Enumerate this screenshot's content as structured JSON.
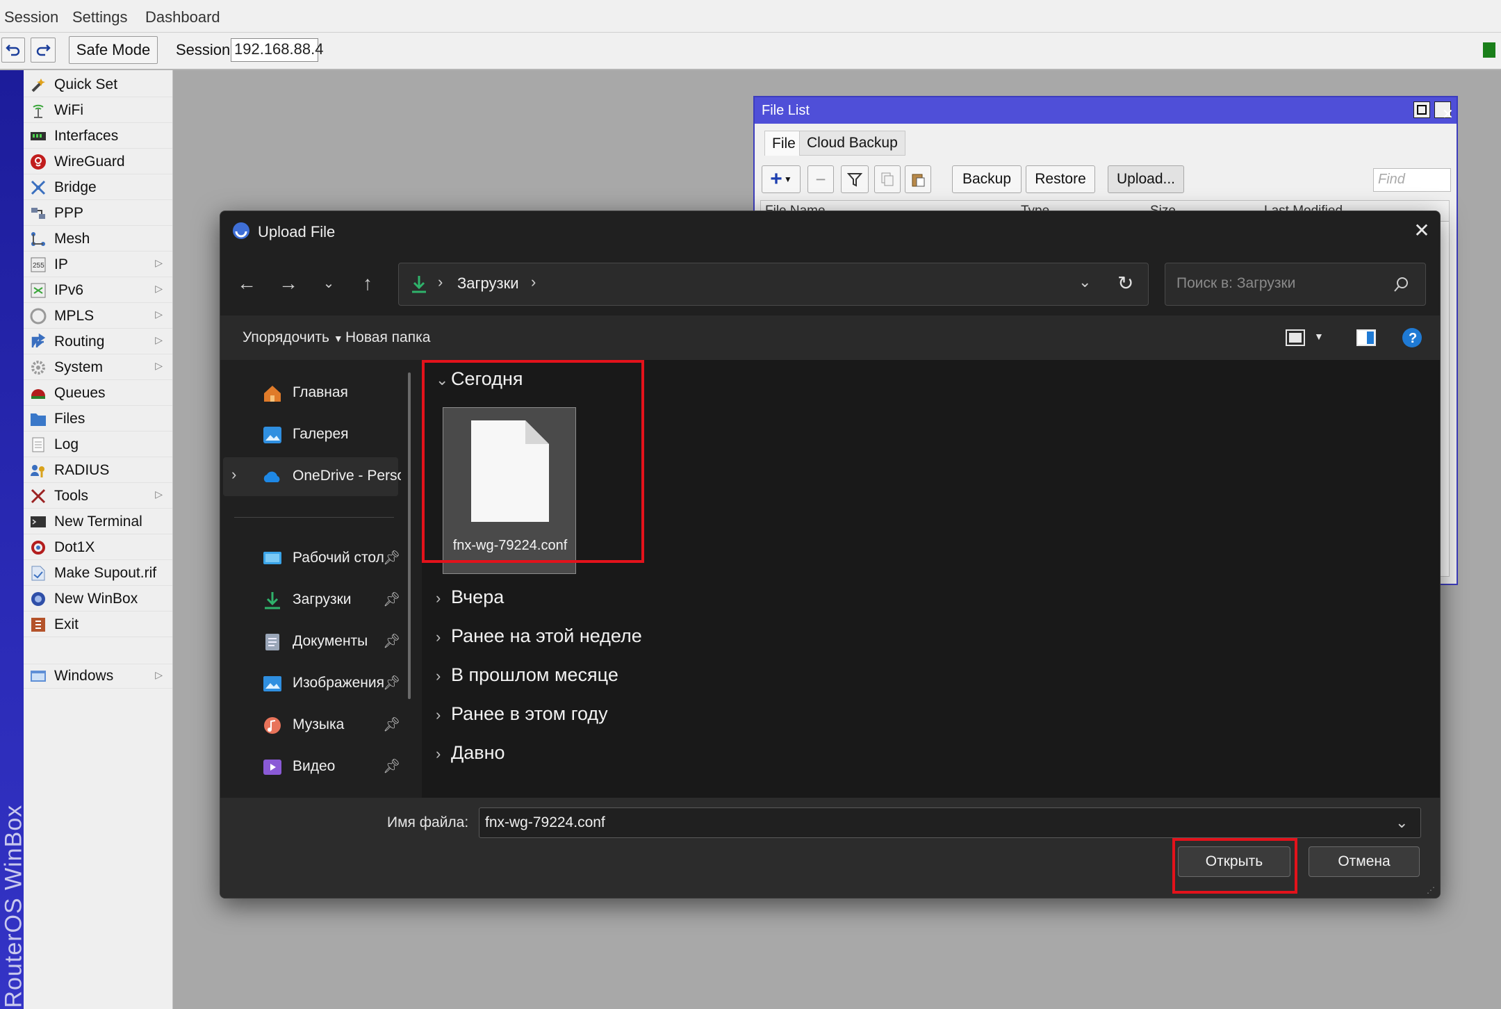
{
  "winbox": {
    "menu": [
      "Session",
      "Settings",
      "Dashboard"
    ],
    "safe_mode": "Safe Mode",
    "session_label": "Session:",
    "session_value": "192.168.88.4",
    "brand_vertical": "RouterOS WinBox"
  },
  "sidebar": {
    "items": [
      {
        "label": "Quick Set",
        "icon": "wand-icon"
      },
      {
        "label": "WiFi",
        "icon": "wifi-icon"
      },
      {
        "label": "Interfaces",
        "icon": "interfaces-icon"
      },
      {
        "label": "WireGuard",
        "icon": "wireguard-icon"
      },
      {
        "label": "Bridge",
        "icon": "bridge-icon"
      },
      {
        "label": "PPP",
        "icon": "ppp-icon"
      },
      {
        "label": "Mesh",
        "icon": "mesh-icon"
      },
      {
        "label": "IP",
        "icon": "ip-icon"
      },
      {
        "label": "IPv6",
        "icon": "ipv6-icon"
      },
      {
        "label": "MPLS",
        "icon": "mpls-icon"
      },
      {
        "label": "Routing",
        "icon": "routing-icon"
      },
      {
        "label": "System",
        "icon": "gear-icon"
      },
      {
        "label": "Queues",
        "icon": "queues-icon"
      },
      {
        "label": "Files",
        "icon": "folder-icon"
      },
      {
        "label": "Log",
        "icon": "log-icon"
      },
      {
        "label": "RADIUS",
        "icon": "radius-icon"
      },
      {
        "label": "Tools",
        "icon": "tools-icon"
      },
      {
        "label": "New Terminal",
        "icon": "terminal-icon"
      },
      {
        "label": "Dot1X",
        "icon": "dot1x-icon"
      },
      {
        "label": "Make Supout.rif",
        "icon": "supout-icon"
      },
      {
        "label": "New WinBox",
        "icon": "winbox-icon"
      },
      {
        "label": "Exit",
        "icon": "exit-icon"
      },
      {
        "label": "Windows",
        "icon": "windows-icon"
      }
    ]
  },
  "filelist": {
    "title": "File List",
    "tabs": [
      "File",
      "Cloud Backup"
    ],
    "buttons": {
      "backup": "Backup",
      "restore": "Restore",
      "upload": "Upload..."
    },
    "find_placeholder": "Find",
    "columns": [
      "File Name",
      "Type",
      "Size",
      "Last Modified"
    ]
  },
  "dialog": {
    "title": "Upload File",
    "breadcrumb": "Загрузки",
    "search_placeholder": "Поиск в: Загрузки",
    "organize": "Упорядочить",
    "new_folder": "Новая папка",
    "nav": [
      {
        "label": "Главная",
        "icon": "home-icon"
      },
      {
        "label": "Галерея",
        "icon": "gallery-icon"
      },
      {
        "label": "OneDrive - Personal",
        "icon": "onedrive-icon"
      },
      {
        "label": "Рабочий стол",
        "icon": "desktop-icon"
      },
      {
        "label": "Загрузки",
        "icon": "downloads-icon"
      },
      {
        "label": "Документы",
        "icon": "documents-icon"
      },
      {
        "label": "Изображения",
        "icon": "pictures-icon"
      },
      {
        "label": "Музыка",
        "icon": "music-icon"
      },
      {
        "label": "Видео",
        "icon": "video-icon"
      }
    ],
    "groups": [
      "Сегодня",
      "Вчера",
      "Ранее на этой неделе",
      "В прошлом месяце",
      "Ранее в этом году",
      "Давно"
    ],
    "file_tile": "fnx-wg-79224.conf",
    "filename_label": "Имя файла:",
    "filename_value": "fnx-wg-79224.conf",
    "open": "Открыть",
    "cancel": "Отмена"
  },
  "colors": {
    "winbox_title": "#4f4fd8",
    "dialog_bg": "#202020",
    "highlight_red": "#e3121b",
    "accent_blue": "#0078d4"
  }
}
